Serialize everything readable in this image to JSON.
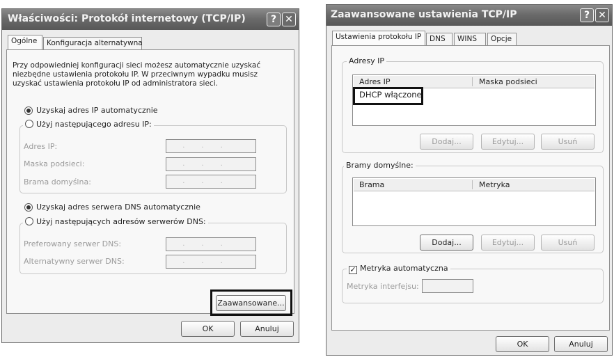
{
  "left_dialog": {
    "title": "Właściwości: Protokół internetowy (TCP/IP)",
    "help_button": "?",
    "close_button": "✕",
    "tabs": [
      "Ogólne",
      "Konfiguracja alternatywna"
    ],
    "description": "Przy odpowiedniej konfiguracji sieci możesz automatycznie uzyskać niezbędne ustawienia protokołu IP. W przeciwnym wypadku musisz uzyskać ustawienia protokołu IP od administratora sieci.",
    "radio_auto_ip": "Uzyskaj adres IP automatycznie",
    "radio_manual_ip": "Użyj następującego adresu IP:",
    "ip_label": "Adres IP:",
    "mask_label": "Maska podsieci:",
    "gateway_label": "Brama domyślna:",
    "radio_auto_dns": "Uzyskaj adres serwera DNS automatycznie",
    "radio_manual_dns": "Użyj następujących adresów serwerów DNS:",
    "preferred_dns_label": "Preferowany serwer DNS:",
    "alternate_dns_label": "Alternatywny serwer DNS:",
    "advanced_button": "Zaawansowane...",
    "ok_button": "OK",
    "cancel_button": "Anuluj",
    "auto_ip_selected": true,
    "auto_dns_selected": true
  },
  "right_dialog": {
    "title": "Zaawansowane ustawienia TCP/IP",
    "help_button": "?",
    "close_button": "✕",
    "tabs": [
      "Ustawienia protokołu IP",
      "DNS",
      "WINS",
      "Opcje"
    ],
    "ip_group": {
      "legend": "Adresy IP",
      "col_ip": "Adres IP",
      "col_mask": "Maska podsieci",
      "entry": "DHCP włączone",
      "add": "Dodaj...",
      "edit": "Edytuj...",
      "remove": "Usuń"
    },
    "gateway_group": {
      "legend": "Bramy domyślne:",
      "col_gateway": "Brama",
      "col_metric": "Metryka",
      "add": "Dodaj...",
      "edit": "Edytuj...",
      "remove": "Usuń"
    },
    "auto_metric_label": "Metryka automatyczna",
    "auto_metric_checked": true,
    "check_mark": "✓",
    "interface_metric_label": "Metryka interfejsu:",
    "ok_button": "OK",
    "cancel_button": "Anuluj"
  }
}
